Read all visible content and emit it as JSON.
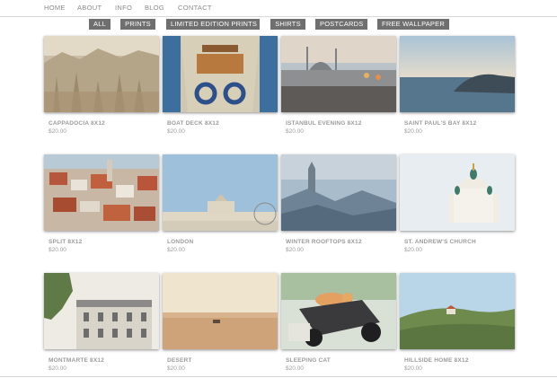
{
  "nav": {
    "items": [
      "HOME",
      "ABOUT",
      "INFO",
      "BLOG",
      "CONTACT"
    ]
  },
  "filters": {
    "items": [
      "ALL",
      "PRINTS",
      "LIMITED EDITION PRINTS",
      "SHIRTS",
      "POSTCARDS",
      "FREE WALLPAPER"
    ]
  },
  "products": [
    {
      "title": "CAPPADOCIA 8X12",
      "price": "$20.00"
    },
    {
      "title": "BOAT DECK 8X12",
      "price": "$20.00"
    },
    {
      "title": "ISTANBUL EVENING 8X12",
      "price": "$20.00"
    },
    {
      "title": "SAINT PAUL'S BAY 8X12",
      "price": "$20.00"
    },
    {
      "title": "SPLIT 8X12",
      "price": "$20.00"
    },
    {
      "title": "LONDON",
      "price": "$20.00"
    },
    {
      "title": "WINTER ROOFTOPS 8X12",
      "price": "$20.00"
    },
    {
      "title": "ST. ANDREW'S CHURCH",
      "price": "$20.00"
    },
    {
      "title": "MONTMARTE 8X12",
      "price": "$20.00"
    },
    {
      "title": "DESERT",
      "price": "$20.00"
    },
    {
      "title": "SLEEPING CAT",
      "price": "$20.00"
    },
    {
      "title": "HILLSIDE HOME 8X12",
      "price": "$20.00"
    }
  ],
  "colors": {
    "nav_text": "#8a8a8a",
    "filter_bg": "#6f6f6f",
    "filter_text": "#ffffff",
    "caption_text": "#9b9b9b"
  }
}
